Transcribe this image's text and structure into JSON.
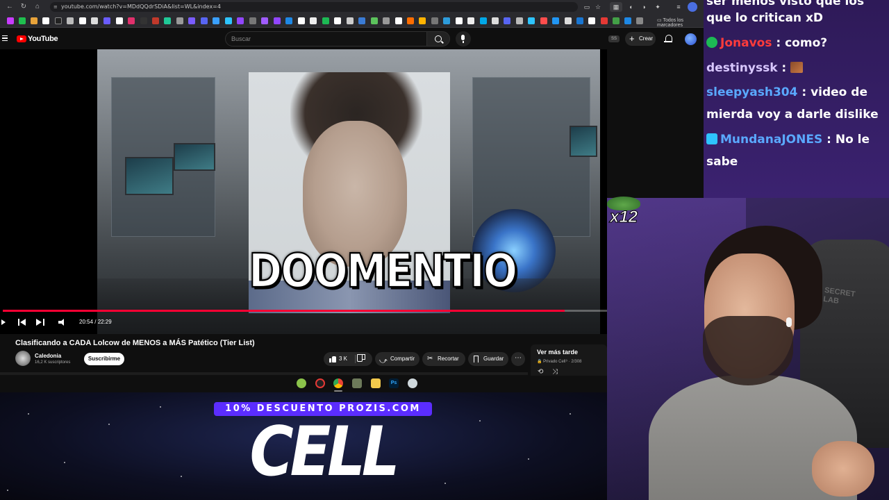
{
  "browser": {
    "url": "youtube.com/watch?v=MDdQQdrSDiA&list=WL&index=4",
    "bookmarks_all_label": "Todos los marcadores"
  },
  "youtube": {
    "logo_text": "YouTube",
    "search_placeholder": "Buscar",
    "create_label": "Crear",
    "ss_badge": "SS"
  },
  "player": {
    "time_display": "20:54 / 22:29",
    "progress_fraction": 0.93,
    "meme_caption": "DOOMENTIO",
    "emote_count": "x12"
  },
  "video": {
    "title": "Clasificando a CADA Lolcow de MENOS a MÁS Patético (Tier List)",
    "channel_name": "Caledonia",
    "channel_subs": "16,2 K suscriptores",
    "subscribe_label": "Suscribirme",
    "like_count": "3 K",
    "share_label": "Compartir",
    "clip_label": "Recortar",
    "save_label": "Guardar",
    "more_label": "⋯"
  },
  "watch_later": {
    "title": "Ver más tarde",
    "meta": "🔒 Privado  Cell⁹ · 2/308"
  },
  "chat": {
    "lines": [
      {
        "user": "",
        "msg": "que lo critican xD",
        "color": "#ffffff"
      },
      {
        "user": "Jonavos",
        "msg": " : como?",
        "color": "#ff3b3b"
      },
      {
        "user": "destinyssk",
        "msg": " : ",
        "color": "#d9c8ff"
      },
      {
        "user": "sleepyash304",
        "msg": " : video de",
        "color": "#5aa9ff"
      },
      {
        "user": "",
        "msg": "mierda voy a darle dislike",
        "color": "#ffffff"
      },
      {
        "user": "MundanaJONES",
        "msg": " : No le",
        "color": "#5aa9ff"
      },
      {
        "user": "",
        "msg": "sabe",
        "color": "#ffffff"
      }
    ]
  },
  "banner": {
    "promo": "10% DESCUENTO PROZIS.COM",
    "brand": "CELL"
  },
  "colors": {
    "youtube_red": "#ff0000",
    "progress_red": "#ff0033",
    "chat_bg": "#2e1a58",
    "promo_purple": "#5b2dff"
  }
}
